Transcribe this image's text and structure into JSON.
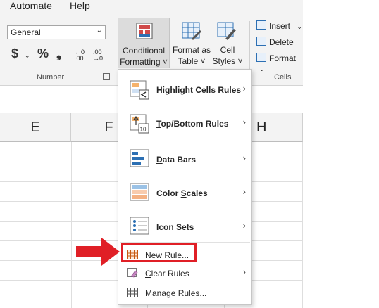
{
  "ribbon": {
    "tabs": [
      "Automate",
      "Help"
    ],
    "number_group": {
      "format_value": "General",
      "currency_symbol": "$",
      "percent_symbol": "%",
      "comma_symbol": "❟",
      "increase_decimal": "←0 .00",
      "decrease_decimal": ".00 →0",
      "label": "Number"
    },
    "conditional_formatting": {
      "line1": "Conditional",
      "line2": "Formatting ˅"
    },
    "format_as_table": {
      "line1": "Format as",
      "line2": "Table ˅"
    },
    "cell_styles": {
      "line1": "Cell",
      "line2": "Styles ˅"
    },
    "cells_group": {
      "insert": "Insert",
      "delete": "Delete",
      "format": "Format",
      "label": "Cells"
    }
  },
  "grid": {
    "columns": [
      "E",
      "F",
      "H"
    ]
  },
  "dropdown": {
    "items": [
      {
        "label_pre": "",
        "label_u": "H",
        "label_post": "ighlight Cells Rules",
        "arrow": "›"
      },
      {
        "label_pre": "",
        "label_u": "T",
        "label_post": "op/Bottom Rules",
        "arrow": "›"
      },
      {
        "label_pre": "",
        "label_u": "D",
        "label_post": "ata Bars",
        "arrow": "›"
      },
      {
        "label_pre": "Color ",
        "label_u": "S",
        "label_post": "cales",
        "arrow": "›"
      },
      {
        "label_pre": "",
        "label_u": "I",
        "label_post": "con Sets",
        "arrow": "›"
      },
      {
        "label_pre": "",
        "label_u": "N",
        "label_post": "ew Rule...",
        "arrow": ""
      },
      {
        "label_pre": "",
        "label_u": "C",
        "label_post": "lear Rules",
        "arrow": "›"
      },
      {
        "label_pre": "Manage ",
        "label_u": "R",
        "label_post": "ules...",
        "arrow": ""
      }
    ],
    "topbottom_icon_text": "10"
  },
  "colors": {
    "highlight": "#e01f26",
    "accent": "#2c6fb3"
  }
}
